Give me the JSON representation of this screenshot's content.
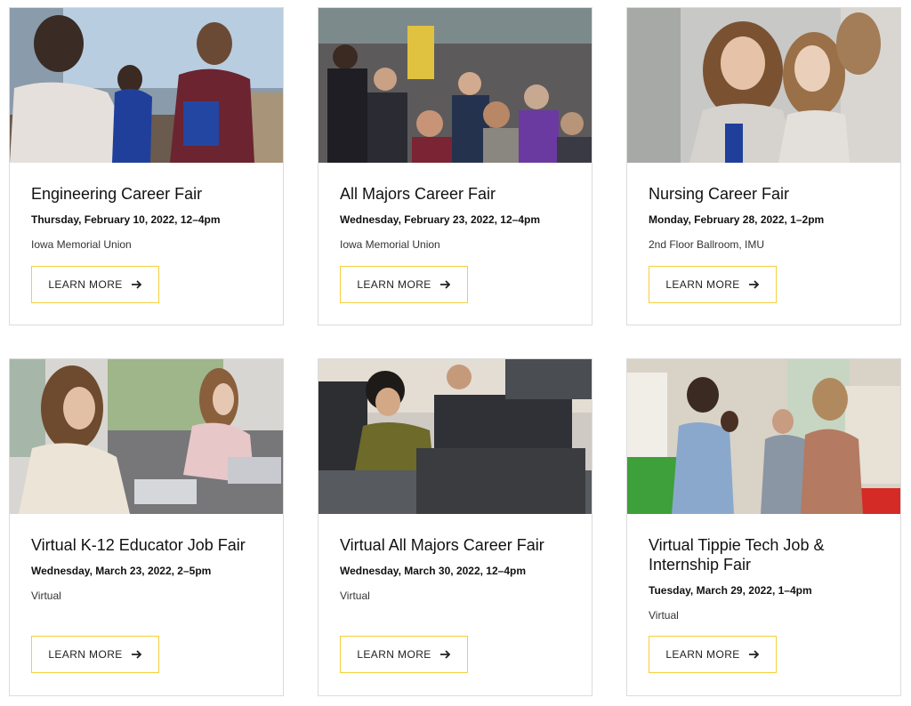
{
  "events": [
    {
      "title": "Engineering Career Fair",
      "date": "Thursday, February 10, 2022, 12–4pm",
      "location": "Iowa Memorial Union",
      "button_label": "LEARN MORE",
      "photo": "students-networking-photo"
    },
    {
      "title": "All Majors Career Fair",
      "date": "Wednesday, February 23, 2022, 12–4pm",
      "location": "Iowa Memorial Union",
      "button_label": "LEARN MORE",
      "photo": "crowded-career-fair-photo"
    },
    {
      "title": "Nursing Career Fair",
      "date": "Monday, February 28, 2022, 1–2pm",
      "location": "2nd Floor Ballroom, IMU",
      "button_label": "LEARN MORE",
      "photo": "smiling-nursing-students-photo"
    },
    {
      "title": "Virtual K-12 Educator Job Fair",
      "date": "Wednesday, March 23, 2022, 2–5pm",
      "location": "Virtual",
      "button_label": "LEARN MORE",
      "photo": "students-on-laptops-photo"
    },
    {
      "title": "Virtual All Majors Career Fair",
      "date": "Wednesday, March 30, 2022, 12–4pm",
      "location": "Virtual",
      "button_label": "LEARN MORE",
      "photo": "computer-lab-student-photo"
    },
    {
      "title": "Virtual Tippie Tech Job & Internship Fair",
      "date": "Tuesday, March 29, 2022, 1–4pm",
      "location": "Virtual",
      "button_label": "LEARN MORE",
      "photo": "employer-booth-photo"
    }
  ],
  "colors": {
    "button_border": "#f5cf3b",
    "card_border": "#dcdcdc",
    "text": "#111111"
  },
  "icons": {
    "button_icon": "arrow-right-icon"
  }
}
